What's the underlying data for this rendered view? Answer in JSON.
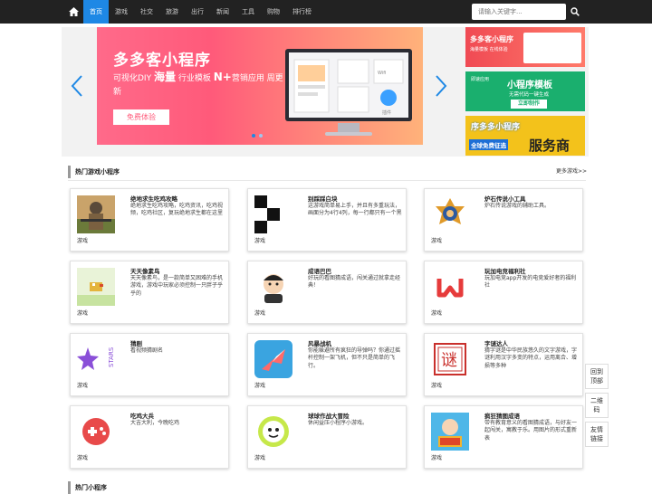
{
  "nav": {
    "items": [
      "首页",
      "游戏",
      "社交",
      "旅游",
      "出行",
      "新闻",
      "工具",
      "购物",
      "排行榜"
    ],
    "active_index": 0,
    "search_placeholder": "请输入关键字..."
  },
  "banner": {
    "title": "多多客小程序",
    "subtitle_parts": [
      "可视化DIY ",
      "海量",
      " 行业模板 ",
      "N+",
      "营销应用 周更新"
    ],
    "button": "免费体验",
    "mock_labels": [
      "Wifi",
      "插件"
    ]
  },
  "ads": [
    {
      "title": "多多客小程序",
      "sub": "海量模板 在线体验"
    },
    {
      "title": "小程序模板",
      "sub": "无需代码一键生成",
      "button": "立即制作",
      "logo": "即速应用"
    },
    {
      "title": "序多多小程序",
      "sub": "全球免费征选",
      "big": "服务商"
    }
  ],
  "section1": {
    "title": "热门游戏小程序",
    "more": "更多游戏>>",
    "cards": [
      {
        "title": "绝地求生吃鸡攻略",
        "desc": "绝地求生吃鸡攻略，吃鸡资讯，吃鸡视频，吃鸡社区，复玩绝地求生都在这里",
        "tag": "游戏",
        "icon": "pubg-soldier-icon"
      },
      {
        "title": "别踩踩白块",
        "desc": "这游戏简单易上手，并且有多重玩法，画面分为4行4列，每一行都只有一个黑",
        "tag": "游戏",
        "icon": "piano-tiles-icon"
      },
      {
        "title": "炉石传说小工具",
        "desc": "炉石传说游戏的辅助工具。",
        "tag": "游戏",
        "icon": "hearthstone-logo-icon"
      },
      {
        "title": "天天像素鸟",
        "desc": "天天像素鸟，是一款简单又困难的手机游戏，游戏中玩家必须控制一只胖子乎乎的",
        "tag": "游戏",
        "icon": "pixel-bird-icon"
      },
      {
        "title": "成语巴巴",
        "desc": "好玩的看图猜成语，闯关通过就拿走经典！",
        "tag": "游戏",
        "icon": "idiom-character-icon"
      },
      {
        "title": "玩加电竞福利社",
        "desc": "玩加电竞app开发的电竞爱好者的福利社",
        "tag": "游戏",
        "icon": "wanjia-logo-icon"
      },
      {
        "title": "猜剧",
        "desc": "看视频猜剧名",
        "tag": "游戏",
        "icon": "stars-logo-icon"
      },
      {
        "title": "风暴战机",
        "desc": "你能躲避所有疯狂的导弹吗？你通过摇杆控制一架飞机，但不只是简单的飞行。",
        "tag": "游戏",
        "icon": "plane-icon"
      },
      {
        "title": "字谜达人",
        "desc": "猜字谜是中华民族悠久的文字游戏，字谜利用汉字多变的特点，运用离合、增损等多种",
        "tag": "游戏",
        "icon": "riddle-character-icon"
      },
      {
        "title": "吃鸡大兵",
        "desc": "大吉大利，今晚吃鸡",
        "tag": "游戏",
        "icon": "gamepad-icon"
      },
      {
        "title": "球球作战大冒险",
        "desc": "休闲益压小程序小游戏。",
        "tag": "游戏",
        "icon": "ball-face-icon"
      },
      {
        "title": "疯狂猜图成语",
        "desc": "带有教育意义的看图猜成语，与好友一起闯关，寓教于乐。用图片的形式重新表",
        "tag": "游戏",
        "icon": "guess-picture-icon"
      }
    ]
  },
  "section2": {
    "title": "热门小程序"
  },
  "side": [
    "回到顶部",
    "二维码",
    "友情链接"
  ],
  "colors": {
    "nav_bg": "#222222",
    "accent": "#1e88e5",
    "banner_pink": "#ff5a7a"
  }
}
